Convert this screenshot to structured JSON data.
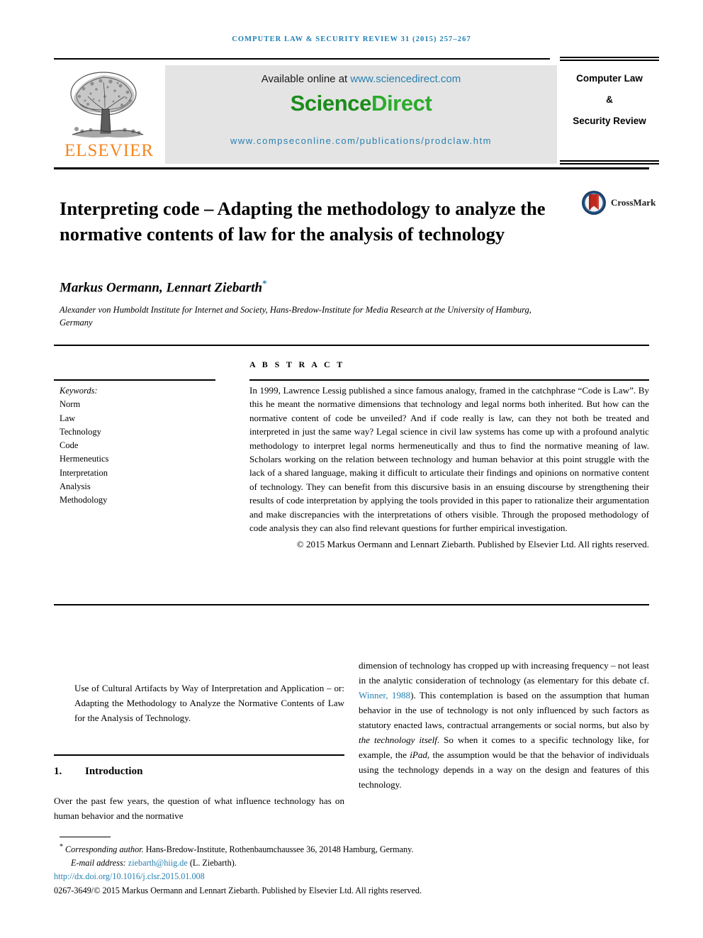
{
  "running_head": "Computer Law & Security Review 31 (2015) 257–267",
  "banner": {
    "available_prefix": "Available online at ",
    "available_link": "www.sciencedirect.com",
    "logo_science": "Science",
    "logo_direct": "Direct",
    "journal_url": "www.compseconline.com/publications/prodclaw.htm"
  },
  "publisher": {
    "name": "ELSEVIER",
    "logo_alt": "elsevier-tree-logo"
  },
  "journal_box": {
    "line1": "Computer Law",
    "line2": "&",
    "line3": "Security Review"
  },
  "article": {
    "title": "Interpreting code – Adapting the methodology to analyze the normative contents of law for the analysis of technology",
    "crossmark_label": "CrossMark",
    "authors": "Markus Oermann, Lennart Ziebarth",
    "author_marker": "*",
    "affiliation": "Alexander von Humboldt Institute for Internet and Society, Hans-Bredow-Institute for Media Research at the University of Hamburg, Germany"
  },
  "keywords": {
    "heading": "Keywords:",
    "items": [
      "Norm",
      "Law",
      "Technology",
      "Code",
      "Hermeneutics",
      "Interpretation",
      "Analysis",
      "Methodology"
    ]
  },
  "abstract": {
    "heading": "A B S T R A C T",
    "body": "In 1999, Lawrence Lessig published a since famous analogy, framed in the catchphrase “Code is Law”. By this he meant the normative dimensions that technology and legal norms both inherited. But how can the normative content of code be unveiled? And if code really is law, can they not both be treated and interpreted in just the same way? Legal science in civil law systems has come up with a profound analytic methodology to interpret legal norms hermeneutically and thus to find the normative meaning of law. Scholars working on the relation between technology and human behavior at this point struggle with the lack of a shared language, making it difficult to articulate their findings and opinions on normative content of technology. They can benefit from this discursive basis in an ensuing discourse by strengthening their results of code interpretation by applying the tools provided in this paper to rationalize their argumentation and make discrepancies with the interpretations of others visible. Through the proposed methodology of code analysis they can also find relevant questions for further empirical investigation.",
    "copyright": "© 2015 Markus Oermann and Lennart Ziebarth. Published by Elsevier Ltd. All rights reserved."
  },
  "body": {
    "epigraph": "Use of Cultural Artifacts by Way of Interpretation and Application – or: Adapting the Methodology to Analyze the Normative Contents of Law for the Analysis of Technology.",
    "section_number": "1.",
    "section_title": "Introduction",
    "left_paragraph": "Over the past few years, the question of what influence technology has on human behavior and the normative",
    "right_part1": "dimension of technology has cropped up with increasing frequency – not least in the analytic consideration of technology (as elementary for this debate cf. ",
    "right_citation": "Winner, 1988",
    "right_part2": "). This contemplation is based on the assumption that human behavior in the use of technology is not only influenced by such factors as statutory enacted laws, contractual arrangements or social norms, but also by ",
    "right_italic1": "the technology itself",
    "right_part3": ". So when it comes to a specific technology like, for example, the ",
    "right_italic2": "iPad",
    "right_part4": ", the assumption would be that the behavior of individuals using the technology depends in a way on the design and features of this technology."
  },
  "footnotes": {
    "star": "*",
    "corresponding_label": "Corresponding author.",
    "corresponding_address": " Hans-Bredow-Institute, Rothenbaumchaussee 36, 20148 Hamburg, Germany.",
    "email_label": "E-mail address: ",
    "email_value": "ziebarth@hiig.de",
    "email_suffix": " (L. Ziebarth).",
    "doi": "http://dx.doi.org/10.1016/j.clsr.2015.01.008",
    "issn_line": "0267-3649/© 2015 Markus Oermann and Lennart Ziebarth. Published by Elsevier Ltd. All rights reserved."
  },
  "colors": {
    "link_blue": "#2780b0",
    "science_green": "#2cab2c",
    "elsevier_orange": "#f5861f",
    "crossmark_red": "#c0281e",
    "crossmark_navy": "#1c3f66"
  }
}
